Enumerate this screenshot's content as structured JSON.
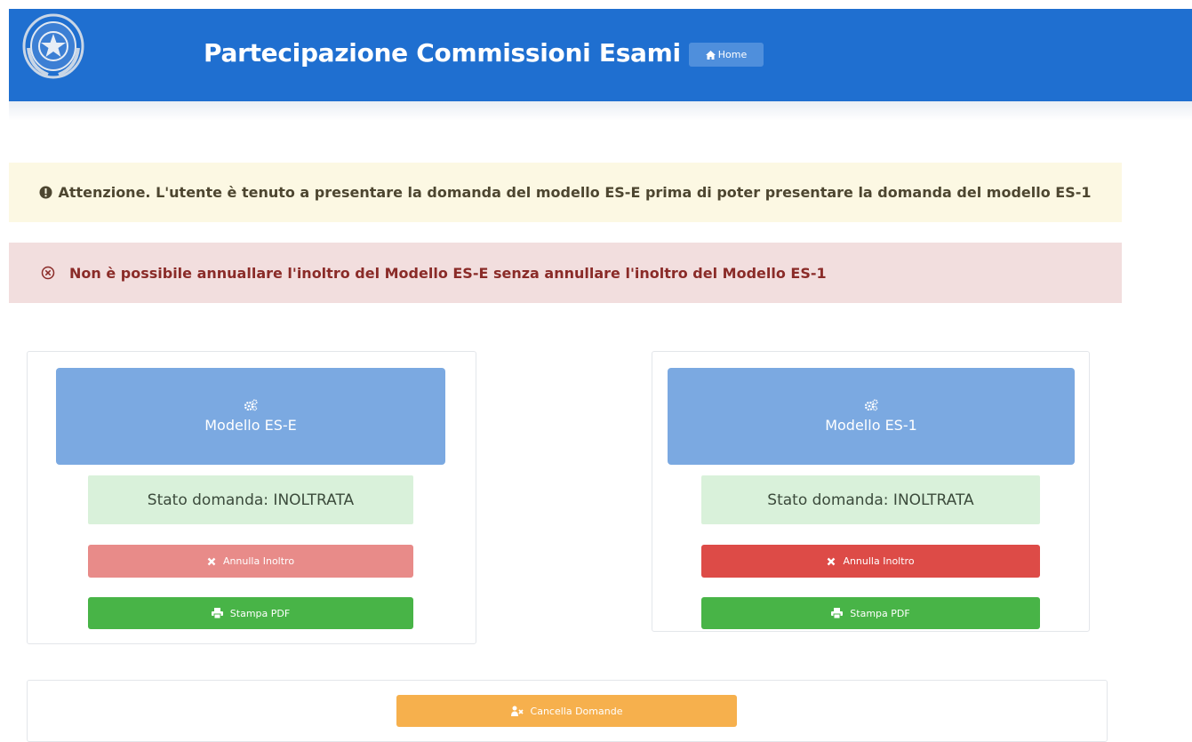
{
  "header": {
    "title": "Partecipazione Commissioni Esami",
    "home_label": "Home",
    "background": "#1f6fd0"
  },
  "alerts": {
    "warning": {
      "icon": "exclamation-circle-icon",
      "text": "Attenzione. L'utente è tenuto a presentare la domanda del modello ES-E prima di poter presentare la domanda del modello ES-1"
    },
    "danger": {
      "icon": "close-circle-icon",
      "text": "Non è possibile annuallare l'inoltro del Modello ES-E senza annullare l'inoltro del Modello ES-1"
    }
  },
  "models": [
    {
      "name": "Modello ES-E",
      "icon": "gears-icon",
      "status": "Stato domanda: INOLTRATA",
      "cancel_label": "Annulla Inoltro",
      "cancel_disabled": true,
      "print_label": "Stampa PDF"
    },
    {
      "name": "Modello ES-1",
      "icon": "gears-icon",
      "status": "Stato domanda: INOLTRATA",
      "cancel_label": "Annulla Inoltro",
      "cancel_disabled": false,
      "print_label": "Stampa PDF"
    }
  ],
  "footer": {
    "delete_label": "Cancella Domande",
    "delete_icon": "person-remove-icon"
  },
  "colors": {
    "primary": "#1f6fd0",
    "tile": "#7ba9e1",
    "success": "#48b447",
    "danger": "#dd4b47",
    "warning": "#f6b04d"
  }
}
